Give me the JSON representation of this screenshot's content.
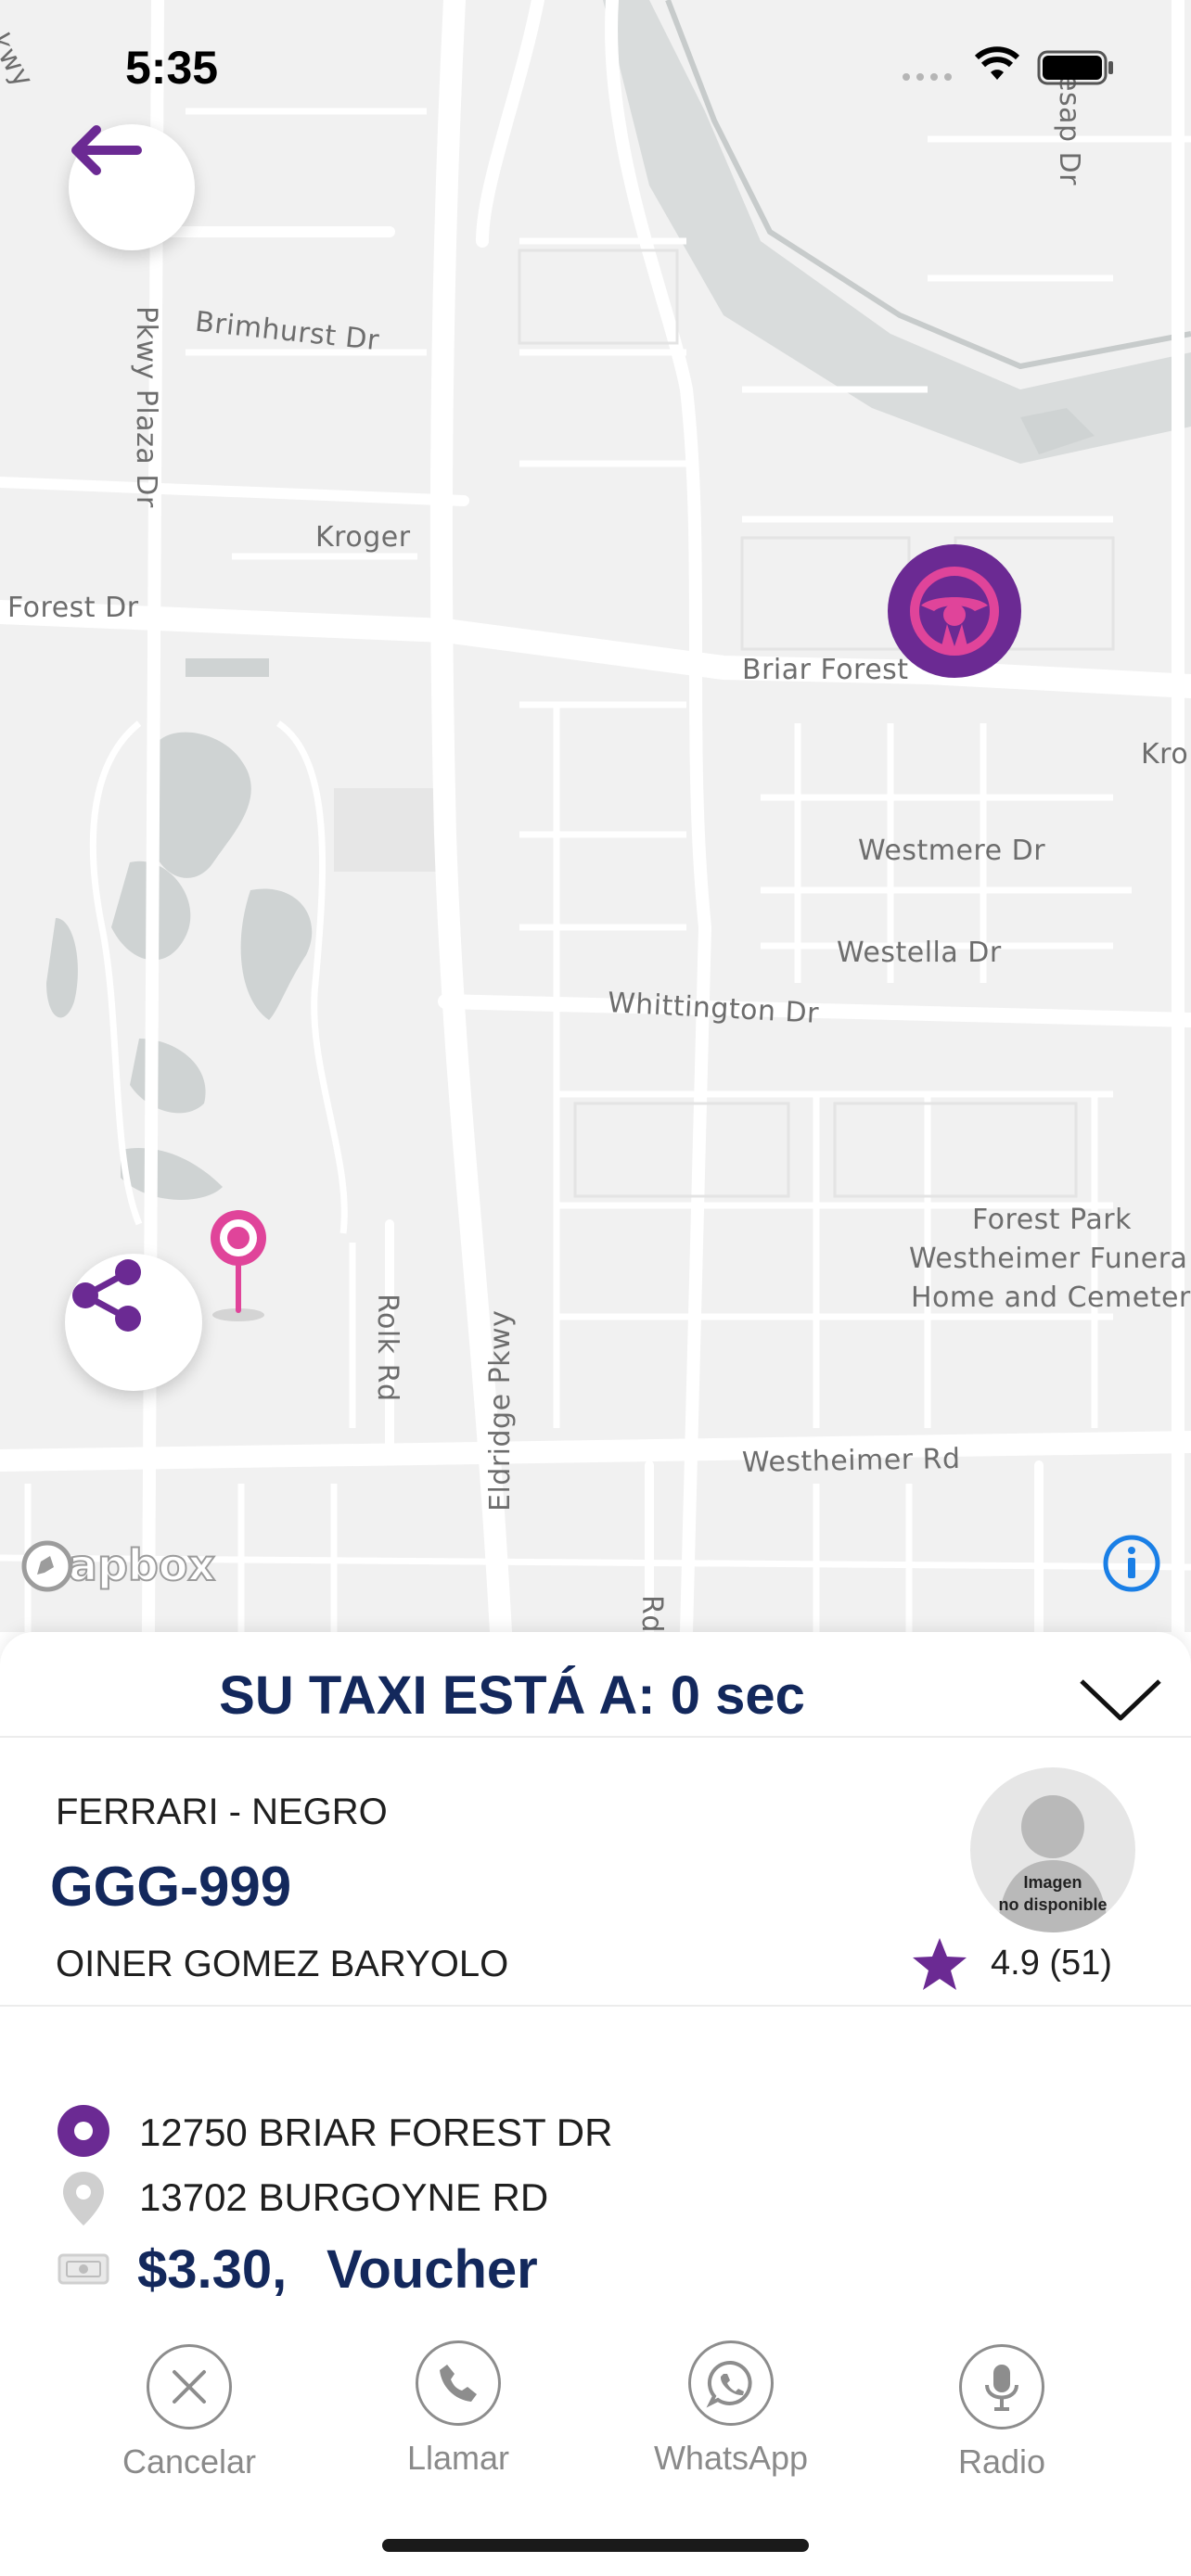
{
  "status_bar": {
    "time": "5:35"
  },
  "map": {
    "labels": {
      "brimhurst": "Brimhurst Dr",
      "pkwy_plaza": "Pkwy Plaza Dr",
      "kroger": "Kroger",
      "forest_dr": "Forest Dr",
      "briar_forest": "Briar Forest",
      "kro": "Kro",
      "westmere": "Westmere Dr",
      "westella": "Westella Dr",
      "whittington": "Whittington Dr",
      "rolk": "Rolk Rd",
      "eldridge": "Eldridge Pkwy",
      "westheimer": "Westheimer Rd",
      "forest_park_1": "Forest Park",
      "forest_park_2": "Westheimer Funera",
      "forest_park_3": "Home and Cemetery",
      "esap": "esap Dr",
      "pkwy_corner": "kwy",
      "rd_bottom": "Rd"
    },
    "attribution": "mapbox"
  },
  "sheet": {
    "title": "SU TAXI ESTÁ A: 0 sec",
    "vehicle": "FERRARI - NEGRO",
    "plate": "GGG-999",
    "driver_name": "OINER GOMEZ BARYOLO",
    "photo_caption_1": "Imagen",
    "photo_caption_2": "no disponible",
    "rating": "4.9 (51)",
    "pickup": "12750 BRIAR FOREST DR",
    "dropoff": "13702 BURGOYNE RD",
    "fare": "$3.30,",
    "payment": "Voucher"
  },
  "actions": {
    "cancel": "Cancelar",
    "call": "Llamar",
    "whatsapp": "WhatsApp",
    "radio": "Radio"
  },
  "colors": {
    "brand_purple": "#6b2a93",
    "pin_pink": "#e0449a",
    "title_navy": "#13285c",
    "info_blue": "#1a7fe6"
  }
}
